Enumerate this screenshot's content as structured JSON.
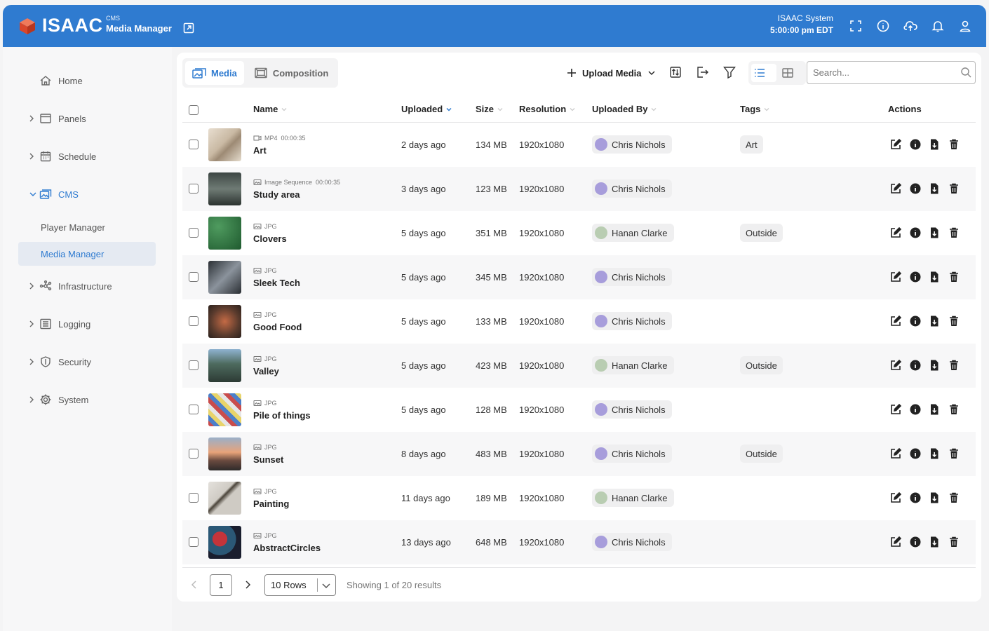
{
  "header": {
    "brand": "ISAAC",
    "section_small": "CMS",
    "section_title": "Media Manager",
    "system_name": "ISAAC System",
    "time": "5:00:00 pm EDT",
    "icons": [
      "external-link-icon",
      "fullscreen-icon",
      "info-icon",
      "cloud-upload-icon",
      "bell-icon",
      "user-icon"
    ]
  },
  "sidebar": {
    "items": [
      {
        "label": "Home",
        "icon": "home-icon"
      },
      {
        "label": "Panels",
        "icon": "panel-icon"
      },
      {
        "label": "Schedule",
        "icon": "calendar-icon"
      },
      {
        "label": "CMS",
        "icon": "media-icon"
      },
      {
        "label": "Infrastructure",
        "icon": "network-icon"
      },
      {
        "label": "Logging",
        "icon": "list-icon"
      },
      {
        "label": "Security",
        "icon": "shield-icon"
      },
      {
        "label": "System",
        "icon": "gear-icon"
      }
    ],
    "cms_sub": [
      {
        "label": "Player Manager"
      },
      {
        "label": "Media Manager"
      }
    ]
  },
  "tabs": [
    {
      "label": "Media"
    },
    {
      "label": "Composition"
    }
  ],
  "toolbar": {
    "upload_label": "Upload Media",
    "search_placeholder": "Search..."
  },
  "table": {
    "columns": [
      "Name",
      "Uploaded",
      "Size",
      "Resolution",
      "Uploaded By",
      "Tags",
      "Actions"
    ],
    "rows": [
      {
        "type": "MP4",
        "duration": "00:00:35",
        "name": "Art",
        "uploaded": "2 days ago",
        "size": "134 MB",
        "resolution": "1920x1080",
        "by": "Chris Nichols",
        "tag": "Art"
      },
      {
        "type": "Image Sequence",
        "duration": "00:00:35",
        "name": "Study area",
        "uploaded": "3 days ago",
        "size": "123 MB",
        "resolution": "1920x1080",
        "by": "Chris Nichols",
        "tag": ""
      },
      {
        "type": "JPG",
        "duration": "",
        "name": "Clovers",
        "uploaded": "5 days ago",
        "size": "351 MB",
        "resolution": "1920x1080",
        "by": "Hanan Clarke",
        "tag": "Outside"
      },
      {
        "type": "JPG",
        "duration": "",
        "name": "Sleek Tech",
        "uploaded": "5 days ago",
        "size": "345 MB",
        "resolution": "1920x1080",
        "by": "Chris Nichols",
        "tag": ""
      },
      {
        "type": "JPG",
        "duration": "",
        "name": "Good Food",
        "uploaded": "5 days ago",
        "size": "133 MB",
        "resolution": "1920x1080",
        "by": "Chris Nichols",
        "tag": ""
      },
      {
        "type": "JPG",
        "duration": "",
        "name": "Valley",
        "uploaded": "5 days ago",
        "size": "423 MB",
        "resolution": "1920x1080",
        "by": "Hanan Clarke",
        "tag": "Outside"
      },
      {
        "type": "JPG",
        "duration": "",
        "name": "Pile of things",
        "uploaded": "5 days ago",
        "size": "128 MB",
        "resolution": "1920x1080",
        "by": "Chris Nichols",
        "tag": ""
      },
      {
        "type": "JPG",
        "duration": "",
        "name": "Sunset",
        "uploaded": "8 days ago",
        "size": "483 MB",
        "resolution": "1920x1080",
        "by": "Chris Nichols",
        "tag": "Outside"
      },
      {
        "type": "JPG",
        "duration": "",
        "name": "Painting",
        "uploaded": "11 days ago",
        "size": "189 MB",
        "resolution": "1920x1080",
        "by": "Hanan Clarke",
        "tag": ""
      },
      {
        "type": "JPG",
        "duration": "",
        "name": "AbstractCircles",
        "uploaded": "13 days ago",
        "size": "648 MB",
        "resolution": "1920x1080",
        "by": "Chris Nichols",
        "tag": ""
      }
    ]
  },
  "footer": {
    "page": "1",
    "rows_option": "10 Rows",
    "showing": "Showing 1 of 20 results"
  },
  "colors": {
    "accent": "#2f7bd0",
    "brand_cube": "#e0573a",
    "avatar_chris": "#a79ddb",
    "avatar_hanan": "#b9cdb2"
  }
}
